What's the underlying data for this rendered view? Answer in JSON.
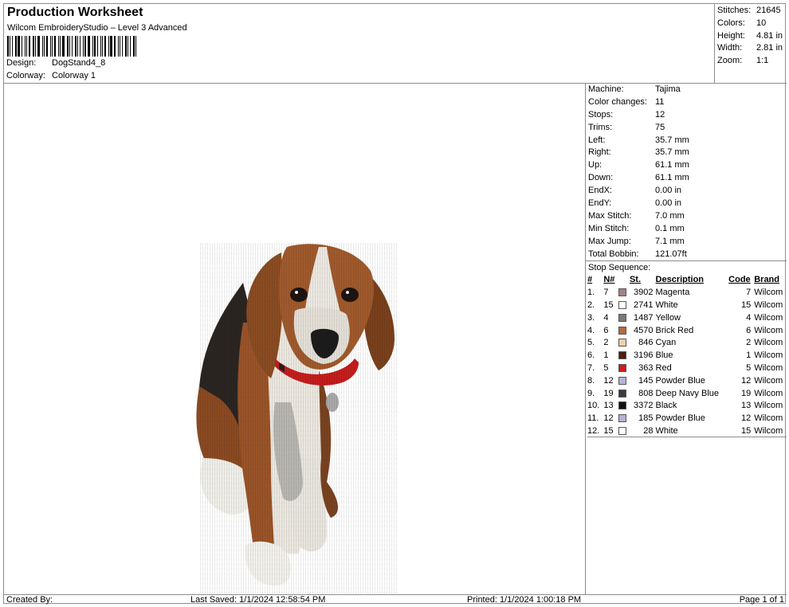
{
  "header": {
    "title": "Production Worksheet",
    "subtitle": "Wilcom EmbroideryStudio – Level 3 Advanced",
    "design_label": "Design:",
    "design_value": "DogStand4_8",
    "colorway_label": "Colorway:",
    "colorway_value": "Colorway 1"
  },
  "stats": [
    {
      "k": "Stitches:",
      "v": "21645"
    },
    {
      "k": "Colors:",
      "v": "10"
    },
    {
      "k": "Height:",
      "v": "4.81 in"
    },
    {
      "k": "Width:",
      "v": "2.81 in"
    },
    {
      "k": "Zoom:",
      "v": "1:1"
    }
  ],
  "machine": [
    {
      "k": "Machine:",
      "v": "Tajima"
    },
    {
      "k": "Color changes:",
      "v": "11"
    },
    {
      "k": "Stops:",
      "v": "12"
    },
    {
      "k": "Trims:",
      "v": "75"
    },
    {
      "k": "Left:",
      "v": "35.7 mm"
    },
    {
      "k": "Right:",
      "v": "35.7 mm"
    },
    {
      "k": "Up:",
      "v": "61.1 mm"
    },
    {
      "k": "Down:",
      "v": "61.1 mm"
    },
    {
      "k": "EndX:",
      "v": "0.00 in"
    },
    {
      "k": "EndY:",
      "v": "0.00 in"
    },
    {
      "k": "Max Stitch:",
      "v": "7.0 mm"
    },
    {
      "k": "Min Stitch:",
      "v": "0.1 mm"
    },
    {
      "k": "Max Jump:",
      "v": "7.1 mm"
    },
    {
      "k": "Total Bobbin:",
      "v": "121.07ft"
    }
  ],
  "sequence": {
    "title": "Stop Sequence:",
    "headers": {
      "num": "#",
      "n": "N#",
      "st": "St.",
      "desc": "Description",
      "code": "Code",
      "brand": "Brand"
    },
    "rows": [
      {
        "num": "1.",
        "n": "7",
        "color": "#a48484",
        "st": "3902",
        "desc": "Magenta",
        "code": "7",
        "brand": "Wilcom"
      },
      {
        "num": "2.",
        "n": "15",
        "color": "#ffffff",
        "st": "2741",
        "desc": "White",
        "code": "15",
        "brand": "Wilcom"
      },
      {
        "num": "3.",
        "n": "4",
        "color": "#7a7a7a",
        "st": "1487",
        "desc": "Yellow",
        "code": "4",
        "brand": "Wilcom"
      },
      {
        "num": "4.",
        "n": "6",
        "color": "#b5693c",
        "st": "4570",
        "desc": "Brick Red",
        "code": "6",
        "brand": "Wilcom"
      },
      {
        "num": "5.",
        "n": "2",
        "color": "#f2cfa8",
        "st": "846",
        "desc": "Cyan",
        "code": "2",
        "brand": "Wilcom"
      },
      {
        "num": "6.",
        "n": "1",
        "color": "#4a1e10",
        "st": "3196",
        "desc": "Blue",
        "code": "1",
        "brand": "Wilcom"
      },
      {
        "num": "7.",
        "n": "5",
        "color": "#d11a1a",
        "st": "363",
        "desc": "Red",
        "code": "5",
        "brand": "Wilcom"
      },
      {
        "num": "8.",
        "n": "12",
        "color": "#b6b3d3",
        "st": "145",
        "desc": "Powder Blue",
        "code": "12",
        "brand": "Wilcom"
      },
      {
        "num": "9.",
        "n": "19",
        "color": "#3a3a42",
        "st": "808",
        "desc": "Deep Navy Blue",
        "code": "19",
        "brand": "Wilcom"
      },
      {
        "num": "10.",
        "n": "13",
        "color": "#111111",
        "st": "3372",
        "desc": "Black",
        "code": "13",
        "brand": "Wilcom"
      },
      {
        "num": "11.",
        "n": "12",
        "color": "#b6b3d3",
        "st": "185",
        "desc": "Powder Blue",
        "code": "12",
        "brand": "Wilcom"
      },
      {
        "num": "12.",
        "n": "15",
        "color": "#ffffff",
        "st": "28",
        "desc": "White",
        "code": "15",
        "brand": "Wilcom"
      }
    ]
  },
  "footer": {
    "created": "Created By:",
    "saved": "Last Saved: 1/1/2024 12:58:54 PM",
    "printed": "Printed: 1/1/2024 1:00:18 PM",
    "page": "Page 1 of 1"
  }
}
